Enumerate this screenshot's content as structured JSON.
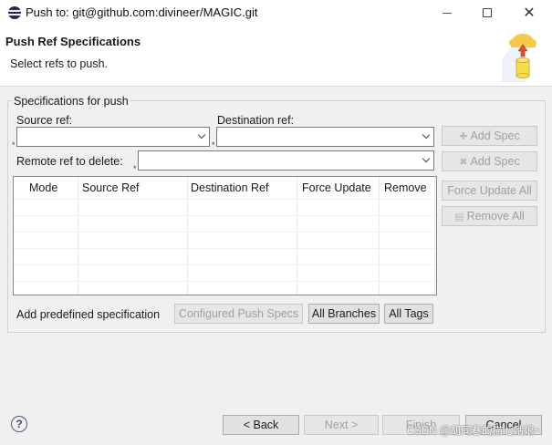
{
  "window": {
    "title": "Push to: git@github.com:divineer/MAGIC.git",
    "minimize_glyph": "—",
    "maximize_glyph": "☐",
    "close_glyph": "✕"
  },
  "header": {
    "title": "Push Ref Specifications",
    "description": "Select refs to push."
  },
  "group": {
    "legend": "Specifications for push",
    "source_label": "Source ref:",
    "source_value": "",
    "destination_label": "Destination ref:",
    "destination_value": "",
    "remote_delete_label": "Remote ref to delete:",
    "remote_delete_value": "",
    "required_marker": "*"
  },
  "side_buttons": {
    "add_spec_1": "Add Spec",
    "add_spec_2": "Add Spec",
    "force_update_all": "Force Update All",
    "remove_all": "Remove All"
  },
  "table": {
    "columns": [
      "Mode",
      "Source Ref",
      "Destination Ref",
      "Force Update",
      "Remove"
    ],
    "rows": []
  },
  "predefined": {
    "label": "Add predefined specification",
    "configured": "Configured Push Specs",
    "all_branches": "All Branches",
    "all_tags": "All Tags"
  },
  "footer": {
    "help": "?",
    "back": "< Back",
    "next": "Next >",
    "finish": "Finish",
    "cancel": "Cancel"
  },
  "watermark": "CSDN @胡同巷的猫七姑娘~",
  "colors": {
    "window_bg": "#f0f0f0",
    "banner_bg": "#ffffff",
    "disabled_text": "#a0a0a0"
  }
}
